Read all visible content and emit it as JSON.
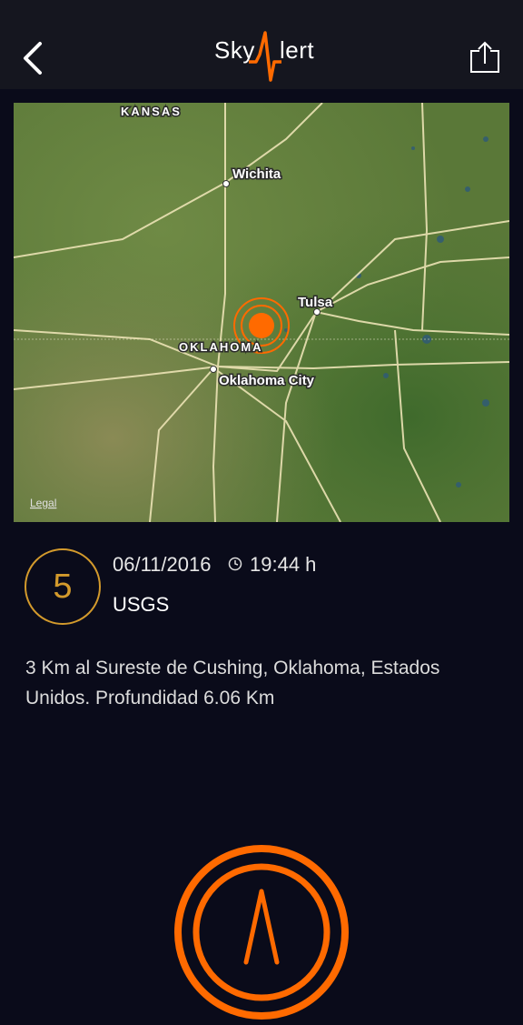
{
  "header": {
    "back_icon": "chevron-left-icon",
    "logo_text_left": "Sky",
    "logo_text_right": "lert",
    "share_icon": "share-icon",
    "accent_color": "#ff6a00"
  },
  "map": {
    "labels": {
      "kansas": "KANSAS",
      "oklahoma": "OKLAHOMA",
      "wichita": "Wichita",
      "tulsa": "Tulsa",
      "okc": "Oklahoma City",
      "legal": "Legal"
    },
    "epicenter_icon": "epicenter-marker-icon"
  },
  "event": {
    "magnitude": "5",
    "date": "06/11/2016",
    "clock_icon": "clock-icon",
    "time": "19:44 h",
    "source": "USGS",
    "description": "3 Km al Sureste de Cushing, Oklahoma, Estados Unidos. Profundidad 6.06 Km",
    "magnitude_color": "#d39a2c"
  },
  "footer": {
    "alert_button_icon": "skyalert-button-icon"
  }
}
